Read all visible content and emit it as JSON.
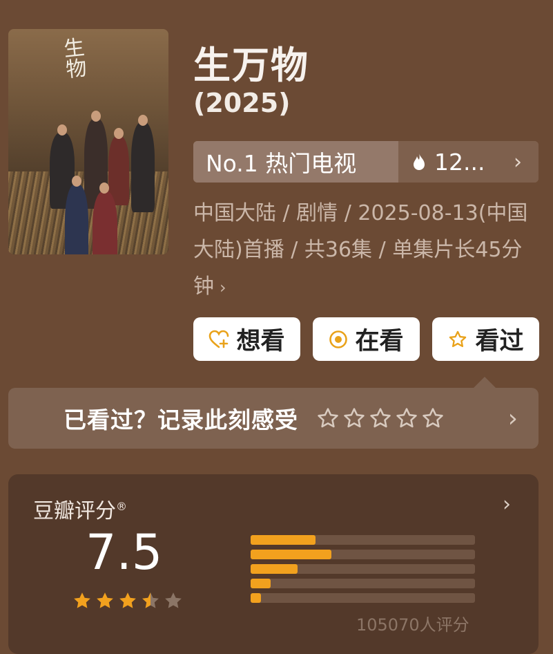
{
  "poster": {
    "logo_text": "生物"
  },
  "title": "生万物",
  "year": "(2025)",
  "rank": {
    "label": "No.1 热门电视",
    "hot_value": "12...",
    "icon": "flame-icon"
  },
  "meta": {
    "text": "中国大陆 / 剧情 / 2025-08-13(中国大陆)首播 / 共36集 / 单集片长45分钟",
    "more_icon": "chevron-right-icon"
  },
  "actions": {
    "want": "想看",
    "watching": "在看",
    "watched": "看过"
  },
  "record": {
    "text": "已看过？记录此刻感受",
    "stars": 5
  },
  "rating": {
    "title": "豆瓣评分",
    "trademark": "®",
    "score": "7.5",
    "stars_filled": 3.5,
    "distribution": [
      {
        "stars": 5,
        "fraction": 0.29
      },
      {
        "stars": 4,
        "fraction": 0.36
      },
      {
        "stars": 3,
        "fraction": 0.21
      },
      {
        "stars": 2,
        "fraction": 0.09
      },
      {
        "stars": 1,
        "fraction": 0.045
      }
    ],
    "count": "105070人评分"
  },
  "colors": {
    "accent": "#f2a11e",
    "background": "#6b4a34",
    "card": "#53392a"
  }
}
